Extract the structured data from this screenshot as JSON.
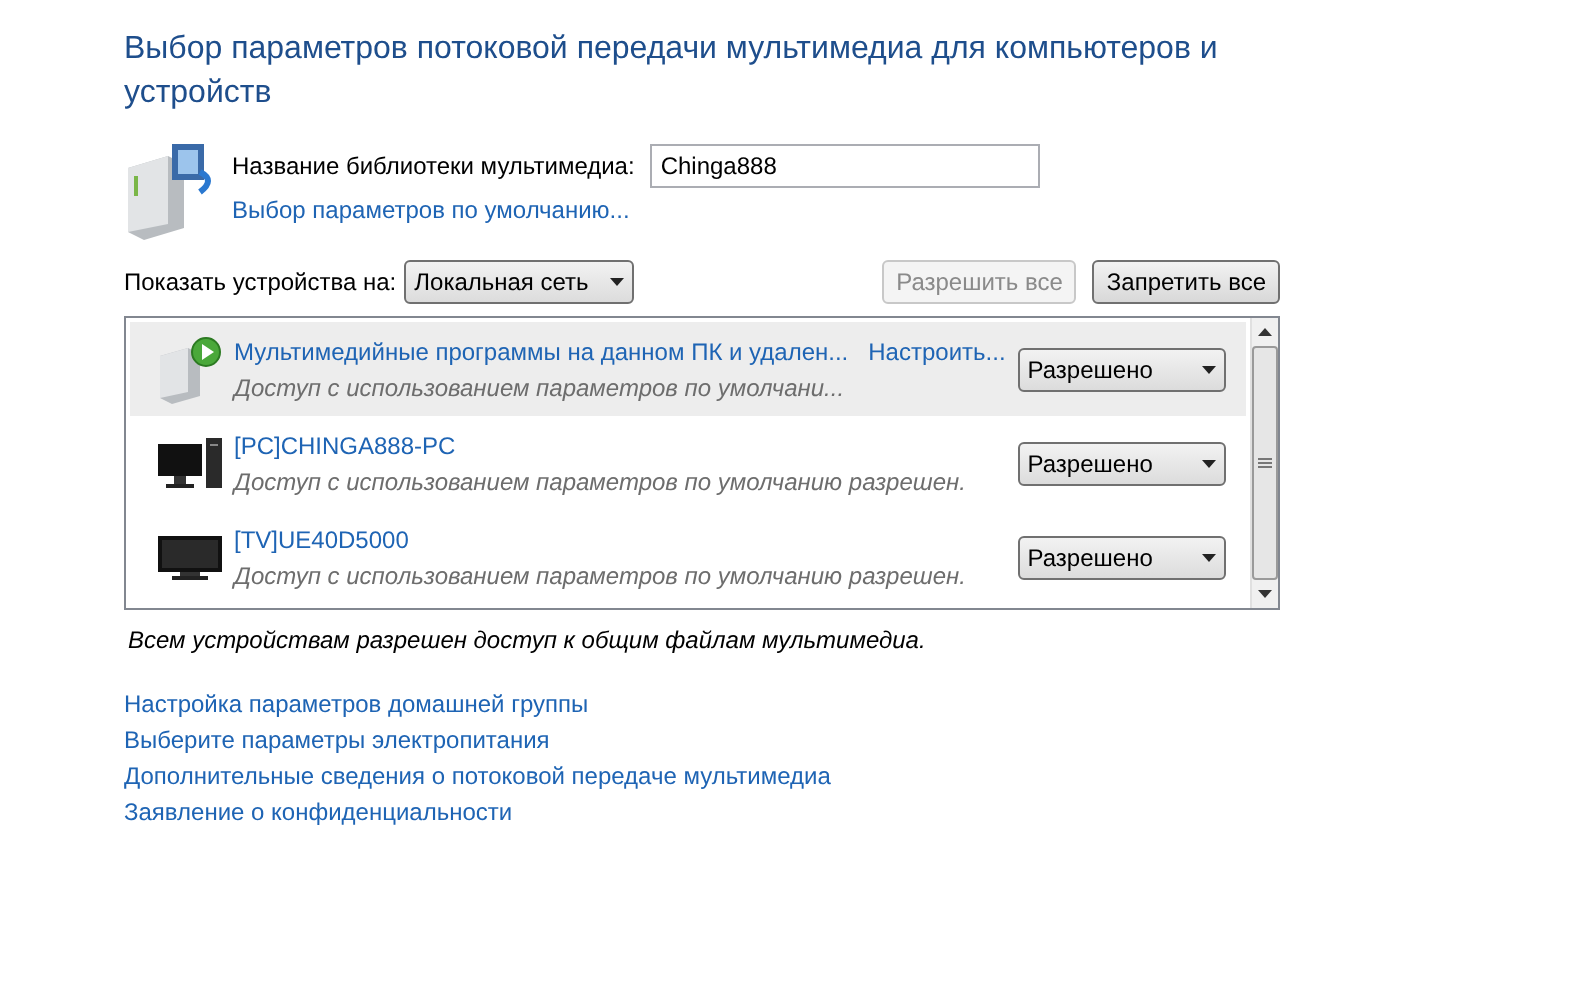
{
  "title": "Выбор параметров потоковой передачи мультимедиа для компьютеров и устройств",
  "library": {
    "label": "Название библиотеки мультимедиа:",
    "value": "Chinga888",
    "defaults_link": "Выбор параметров по умолчанию..."
  },
  "show_devices": {
    "label": "Показать устройства на:",
    "dropdown": "Локальная сеть"
  },
  "buttons": [
    {
      "label": "Разрешить все",
      "disabled": true
    },
    {
      "label": "Запретить все",
      "disabled": false
    }
  ],
  "devices": [
    {
      "kind": "media-programs",
      "name": "Мультимедийные программы на данном ПК и удален...",
      "link": "Настроить...",
      "description": "Доступ с использованием параметров по умолчани...",
      "access": "Разрешено",
      "selected": true
    },
    {
      "kind": "pc",
      "name": "[PC]CHINGA888-PC",
      "description": "Доступ с использованием параметров по умолчанию разрешен.",
      "access": "Разрешено",
      "selected": false
    },
    {
      "kind": "tv",
      "name": "[TV]UE40D5000",
      "description": "Доступ с использованием параметров по умолчанию разрешен.",
      "access": "Разрешено",
      "selected": false
    }
  ],
  "status": "Всем устройствам разрешен доступ к общим файлам мультимедиа.",
  "links": [
    "Настройка параметров домашней группы",
    "Выберите параметры электропитания",
    "Дополнительные сведения о потоковой передаче мультимедиа",
    "Заявление о конфиденциальности"
  ]
}
